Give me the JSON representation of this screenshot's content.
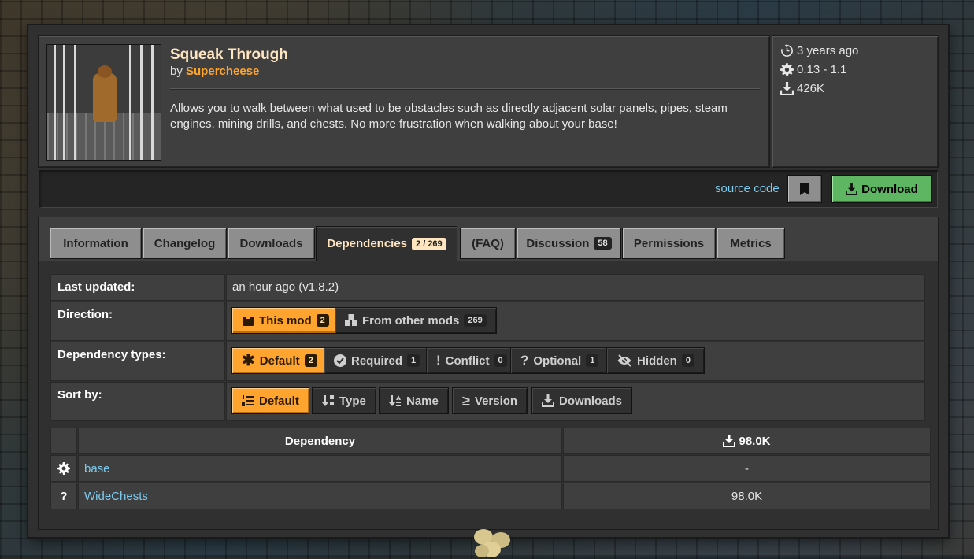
{
  "mod": {
    "title": "Squeak Through",
    "by_label": "by",
    "author": "Supercheese",
    "summary": "Allows you to walk between what used to be obstacles such as directly adjacent solar panels, pipes, steam engines, mining drills, and chests. No more frustration when walking about your base!",
    "updated": "3 years ago",
    "versions": "0.13 - 1.1",
    "downloads": "426K"
  },
  "actions": {
    "source_code": "source code",
    "download": "Download"
  },
  "tabs": [
    {
      "label": "Information",
      "badge": ""
    },
    {
      "label": "Changelog",
      "badge": ""
    },
    {
      "label": "Downloads",
      "badge": ""
    },
    {
      "label": "Dependencies",
      "badge": "2 / 269"
    },
    {
      "label": "(FAQ)",
      "badge": ""
    },
    {
      "label": "Discussion",
      "badge": "58"
    },
    {
      "label": "Permissions",
      "badge": ""
    },
    {
      "label": "Metrics",
      "badge": ""
    }
  ],
  "filters": {
    "last_updated_label": "Last updated:",
    "last_updated_value": "an hour ago (v1.8.2)",
    "direction_label": "Direction:",
    "direction": [
      {
        "label": "This mod",
        "count": "2"
      },
      {
        "label": "From other mods",
        "count": "269"
      }
    ],
    "types_label": "Dependency types:",
    "types": [
      {
        "label": "Default",
        "count": "2"
      },
      {
        "label": "Required",
        "count": "1"
      },
      {
        "label": "Conflict",
        "count": "0"
      },
      {
        "label": "Optional",
        "count": "1"
      },
      {
        "label": "Hidden",
        "count": "0"
      }
    ],
    "sort_label": "Sort by:",
    "sort": [
      "Default",
      "Type",
      "Name",
      "Version",
      "Downloads"
    ]
  },
  "table": {
    "col_dependency": "Dependency",
    "col_downloads": "98.0K",
    "rows": [
      {
        "type_icon": "gear-icon",
        "type_glyph": "",
        "name": "base",
        "downloads": "-"
      },
      {
        "type_icon": "question-icon",
        "type_glyph": "?",
        "name": "WideChests",
        "downloads": "98.0K"
      }
    ]
  },
  "colors": {
    "accent": "#ffa42e",
    "link": "#7dcaed",
    "green": "#5eb663"
  }
}
